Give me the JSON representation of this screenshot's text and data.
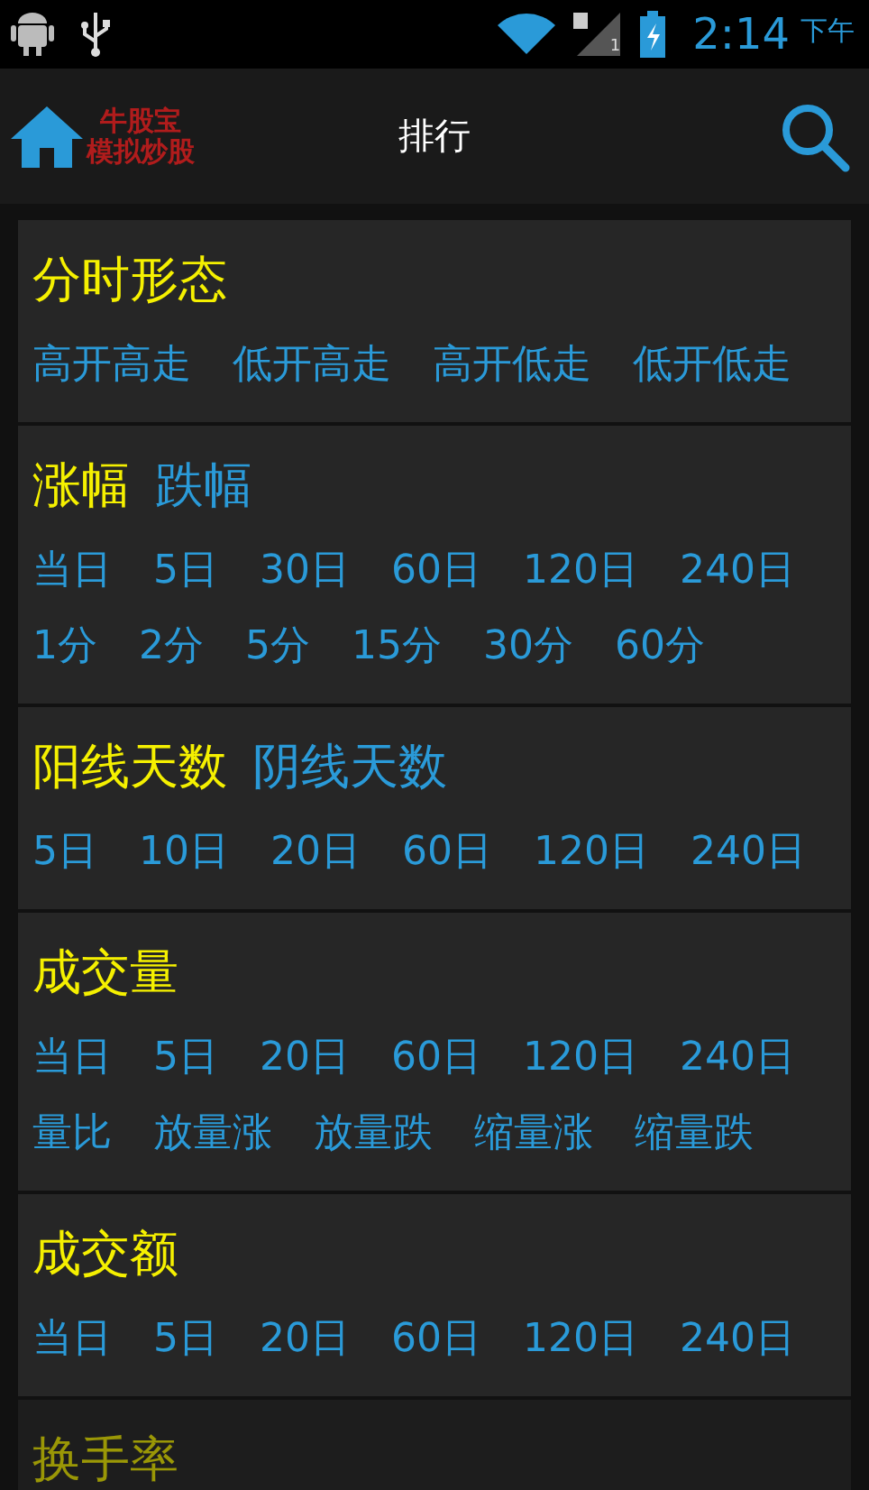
{
  "status_bar": {
    "time": "2:14",
    "period": "下午",
    "sim_label": "1"
  },
  "action_bar": {
    "logo_line_1": "牛股宝",
    "logo_line_2": "模拟炒股",
    "title": "排行"
  },
  "sections": [
    {
      "titles": [
        {
          "label": "分时形态",
          "selected": true
        }
      ],
      "lines": [
        {
          "links": [
            "高开高走",
            "低开高走",
            "高开低走",
            "低开低走"
          ]
        }
      ]
    },
    {
      "titles": [
        {
          "label": "涨幅",
          "selected": true
        },
        {
          "label": "跌幅",
          "selected": false
        }
      ],
      "lines": [
        {
          "links": [
            "当日",
            "5日",
            "30日",
            "60日",
            "120日",
            "240日"
          ]
        },
        {
          "links": [
            "1分",
            "2分",
            "5分",
            "15分",
            "30分",
            "60分"
          ]
        }
      ]
    },
    {
      "titles": [
        {
          "label": "阳线天数",
          "selected": true
        },
        {
          "label": "阴线天数",
          "selected": false
        }
      ],
      "lines": [
        {
          "links": [
            "5日",
            "10日",
            "20日",
            "60日",
            "120日",
            "240日"
          ]
        }
      ]
    },
    {
      "titles": [
        {
          "label": "成交量",
          "selected": true
        }
      ],
      "lines": [
        {
          "links": [
            "当日",
            "5日",
            "20日",
            "60日",
            "120日",
            "240日"
          ]
        },
        {
          "links": [
            "量比",
            "放量涨",
            "放量跌",
            "缩量涨",
            "缩量跌"
          ]
        }
      ]
    },
    {
      "titles": [
        {
          "label": "成交额",
          "selected": true
        }
      ],
      "lines": [
        {
          "links": [
            "当日",
            "5日",
            "20日",
            "60日",
            "120日",
            "240日"
          ]
        }
      ]
    },
    {
      "titles": [
        {
          "label": "换手率",
          "selected": true
        }
      ]
    }
  ]
}
